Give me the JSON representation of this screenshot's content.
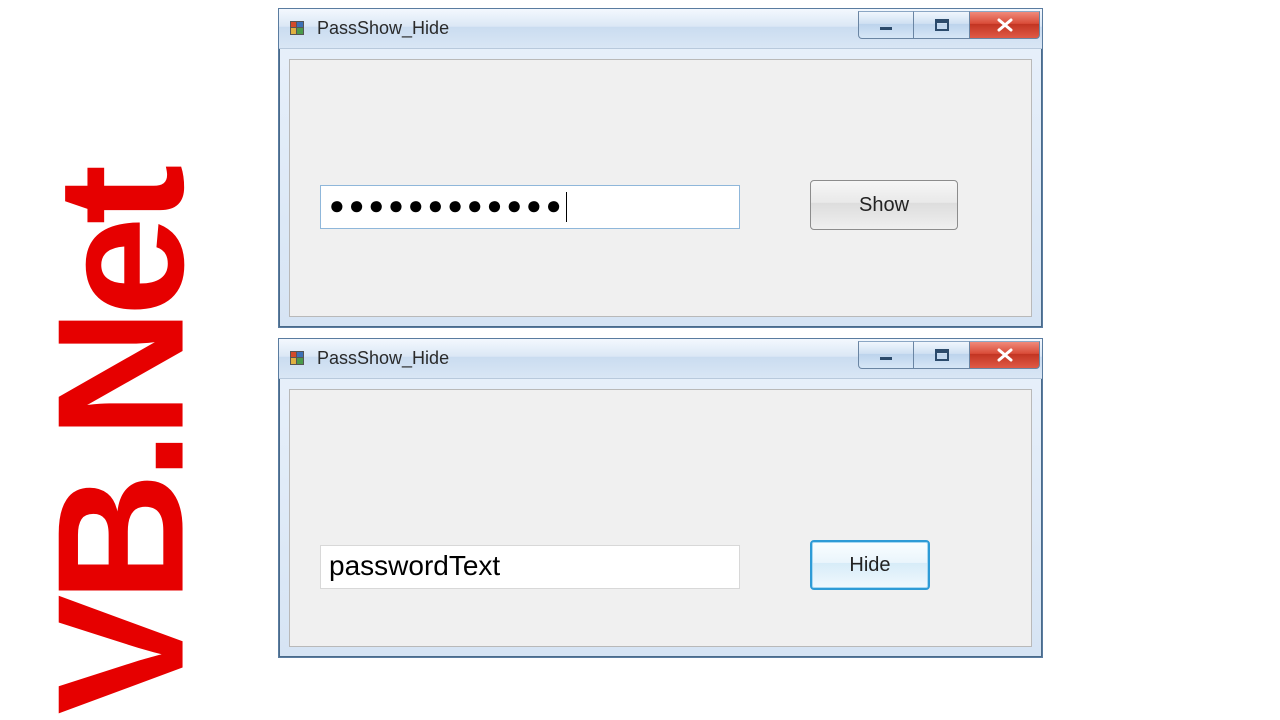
{
  "sidebar_label": "VB.Net",
  "window1": {
    "title": "PassShow_Hide",
    "password_masked": "●●●●●●●●●●●●",
    "button_label": "Show"
  },
  "window2": {
    "title": "PassShow_Hide",
    "password_plain": "passwordText",
    "button_label": "Hide"
  }
}
